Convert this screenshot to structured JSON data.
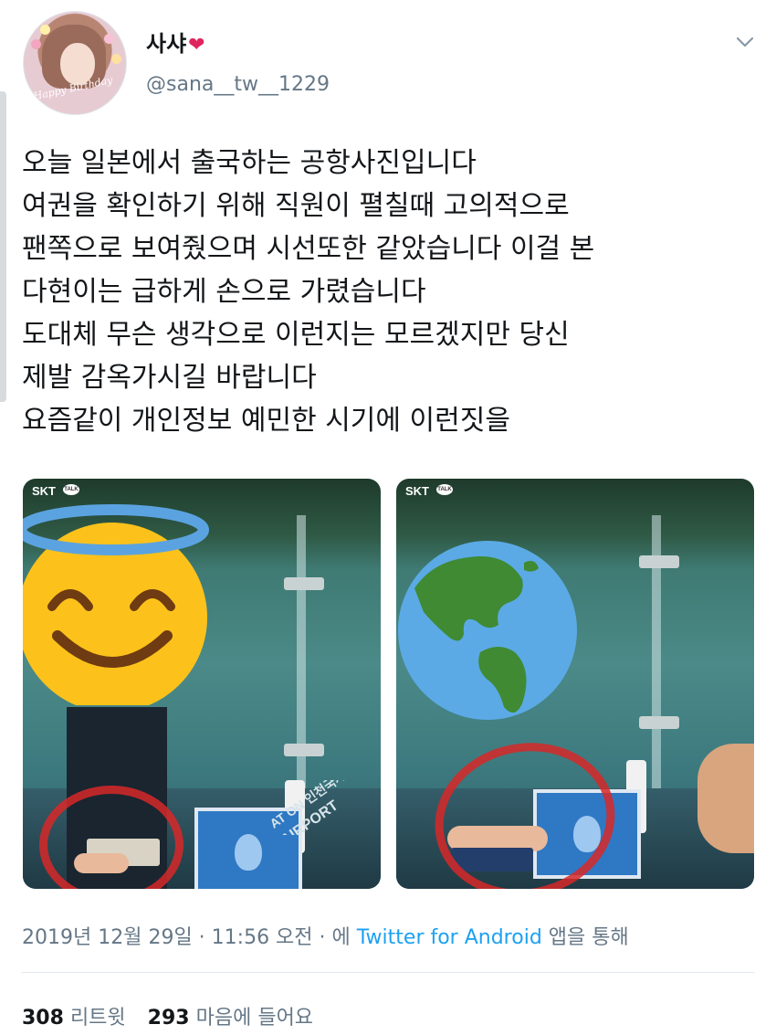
{
  "user": {
    "display_name": "사샤",
    "heart_emoji": "❤",
    "handle": "@sana__tw__1229",
    "avatar_text": "Happy Birthday"
  },
  "tweet": {
    "lines": [
      "오늘 일본에서 출국하는 공항사진입니다",
      "여권을 확인하기 위해 직원이 펼칠때 고의적으로",
      "팬쪽으로 보여줬으며 시선또한 같았습니다 이걸 본",
      "다현이는 급하게 손으로 가렸습니다",
      "도대체 무슨 생각으로 이런지는 모르겠지만 당신",
      "제발 감옥가시길 바랍니다",
      "요즘같이 개인정보 예민한 시기에 이런짓을"
    ]
  },
  "photos": [
    {
      "status_carrier": "SKT",
      "talk_badge": "TALK",
      "sign_text": "AT ON 인천국제",
      "sign_text2": "AIRPORT",
      "overlay": "smiling-face-with-halo"
    },
    {
      "status_carrier": "SKT",
      "talk_badge": "TALK",
      "overlay": "globe-americas"
    }
  ],
  "meta": {
    "timestamp": "2019년 12월 29일 · 11:56 오전 · 에 ",
    "source": "Twitter for Android",
    "source_suffix": " 앱을 통해"
  },
  "stats": {
    "retweets_count": "308",
    "retweets_label": "리트윗",
    "likes_count": "293",
    "likes_label": "마음에 들어요"
  },
  "icons": {
    "menu": "chevron-down-icon"
  },
  "colors": {
    "text": "#14171a",
    "secondary": "#657786",
    "link": "#1da1f2",
    "heart": "#e0245e",
    "divider": "#e1e8ed"
  }
}
